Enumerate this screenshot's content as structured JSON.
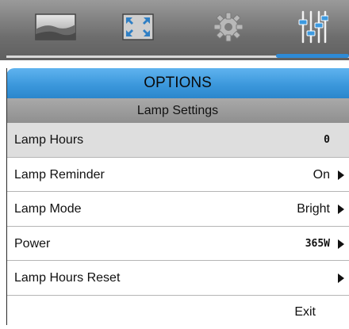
{
  "tabs": [
    {
      "icon": "image-icon"
    },
    {
      "icon": "fullscreen-icon"
    },
    {
      "icon": "gear-icon"
    },
    {
      "icon": "sliders-icon",
      "active": true
    }
  ],
  "header": {
    "title": "OPTIONS",
    "subtitle": "Lamp Settings"
  },
  "menu": {
    "items": [
      {
        "label": "Lamp Hours",
        "value": "0",
        "selected": true,
        "has_arrow": false
      },
      {
        "label": "Lamp Reminder",
        "value": "On",
        "has_arrow": true
      },
      {
        "label": "Lamp Mode",
        "value": "Bright",
        "has_arrow": true
      },
      {
        "label": "Power",
        "value": "365W",
        "has_arrow": true
      },
      {
        "label": "Lamp Hours Reset",
        "value": "",
        "has_arrow": true
      }
    ],
    "exit_label": "Exit"
  },
  "colors": {
    "accent": "#3c98dc",
    "active_tab_underline": "#2e8ad6",
    "selected_row": "#dedede"
  }
}
